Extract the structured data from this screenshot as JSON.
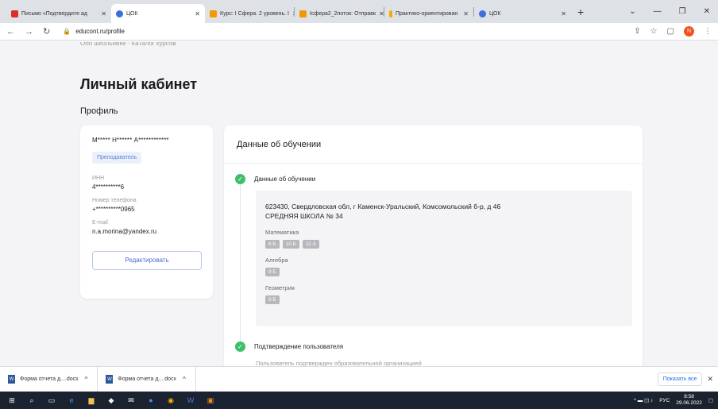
{
  "browser": {
    "tabs": [
      {
        "title": "Письмо «Подтвердите ад",
        "color": "#d93025"
      },
      {
        "title": "ЦОК",
        "color": "#3b6fe0"
      },
      {
        "title": "Курс: I Сфера. 2 уровень. I",
        "color": "#f29900"
      },
      {
        "title": "Icфера2_2поток: Отправк",
        "color": "#f29900"
      },
      {
        "title": "Практико-ориентирован",
        "color": "#f9ab00"
      },
      {
        "title": "ЦОК",
        "color": "#3b6fe0"
      }
    ],
    "url": "educont.ru/profile",
    "profile_initial": "N"
  },
  "page": {
    "breadcrumbs": "Обо школьнике · Каталог курсов",
    "title": "Личный кабинет",
    "section": "Профиль",
    "profile": {
      "full_name": "М***** Н****** А************",
      "role": "Преподаватель",
      "fields": [
        {
          "label": "ИНН",
          "value": "4**********6"
        },
        {
          "label": "Номер телефона",
          "value": "+**********0965"
        },
        {
          "label": "E-mail",
          "value": "n.a.morina@yandex.ru"
        }
      ],
      "edit_label": "Редактировать"
    },
    "education": {
      "header": "Данные об обучении",
      "step1": "Данные об обучении",
      "school": "623430, Свердловская обл, г Каменск-Уральский, Комсомольский б-р, д 46 СРЕДНЯЯ ШКОЛА № 34",
      "subjects": [
        {
          "name": "Математика",
          "grades": [
            "6 Б",
            "10 Б",
            "11 А"
          ]
        },
        {
          "name": "Алгебра",
          "grades": [
            "9 Б"
          ]
        },
        {
          "name": "Геометрия",
          "grades": [
            "9 Б"
          ]
        }
      ],
      "step2": "Подтверждение пользователя",
      "step2_sub": "Пользователь подтвержден образовательной организацией"
    }
  },
  "downloads": {
    "items": [
      {
        "name": "Форма отчета д....docx"
      },
      {
        "name": "Форма отчета д....docx"
      }
    ],
    "show_all": "Показать все"
  },
  "taskbar": {
    "lang": "РУС",
    "time": "8:58",
    "date": "29.06.2022"
  }
}
